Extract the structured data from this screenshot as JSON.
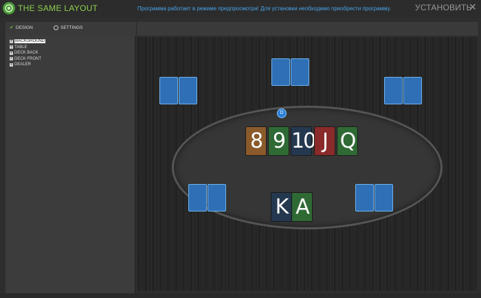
{
  "titlebar": {
    "app_title": "THE SAME LAYOUT",
    "preview_notice": "Программа работает в режиме предпросмотра! Для установки необходимо приобрести программу.",
    "install_label": "УСТАНОВИТЬ",
    "close_glyph": "✕"
  },
  "toolbar": {
    "tabs": [
      {
        "label": "DESIGN",
        "selected": true
      },
      {
        "label": "SETTINGS",
        "selected": false
      }
    ]
  },
  "tree": {
    "items": [
      {
        "label": "BACKGROUND",
        "selected": true
      },
      {
        "label": "TABLE",
        "selected": false
      },
      {
        "label": "DECK BACK",
        "selected": false
      },
      {
        "label": "DECK FRONT",
        "selected": false
      },
      {
        "label": "DEALER",
        "selected": false
      }
    ]
  },
  "preview": {
    "dealer_label": "D",
    "board_cards": [
      {
        "rank": "8",
        "color": "#8a5a2b"
      },
      {
        "rank": "9",
        "color": "#2f6a34"
      },
      {
        "rank": "10",
        "color": "#24384f"
      },
      {
        "rank": "J",
        "color": "#8a2a2a"
      },
      {
        "rank": "Q",
        "color": "#2f6a34"
      }
    ],
    "hero_cards": [
      {
        "rank": "K",
        "color": "#24384f"
      },
      {
        "rank": "A",
        "color": "#2f6a34"
      }
    ]
  },
  "colors": {
    "accent_green": "#8fd14f",
    "notice_blue": "#4aa3e8",
    "seat_blue": "#2f6fb5"
  }
}
